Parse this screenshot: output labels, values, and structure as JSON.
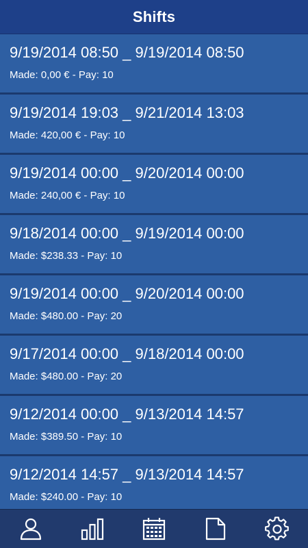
{
  "header": {
    "title": "Shifts"
  },
  "shifts": [
    {
      "range": "9/19/2014 08:50 _ 9/19/2014 08:50",
      "info": "Made: 0,00 € - Pay: 10"
    },
    {
      "range": "9/19/2014 19:03 _ 9/21/2014 13:03",
      "info": "Made: 420,00 € - Pay: 10"
    },
    {
      "range": "9/19/2014 00:00 _ 9/20/2014 00:00",
      "info": "Made: 240,00 € - Pay: 10"
    },
    {
      "range": "9/18/2014 00:00 _ 9/19/2014 00:00",
      "info": "Made: $238.33 - Pay: 10"
    },
    {
      "range": "9/19/2014 00:00 _ 9/20/2014 00:00",
      "info": "Made: $480.00 - Pay: 20"
    },
    {
      "range": "9/17/2014 00:00 _ 9/18/2014 00:00",
      "info": "Made: $480.00 - Pay: 20"
    },
    {
      "range": "9/12/2014 00:00 _ 9/13/2014 14:57",
      "info": "Made: $389.50 - Pay: 10"
    },
    {
      "range": "9/12/2014 14:57 _ 9/13/2014 14:57",
      "info": "Made: $240.00 - Pay: 10"
    }
  ],
  "tabbar": {
    "items": [
      {
        "icon": "person-icon"
      },
      {
        "icon": "bar-chart-icon"
      },
      {
        "icon": "calendar-icon"
      },
      {
        "icon": "document-icon"
      },
      {
        "icon": "gear-icon"
      }
    ]
  },
  "colors": {
    "header_bg": "#1e4089",
    "row_bg": "#2e5fa3",
    "row_divider": "#1b3a6e",
    "tabbar_bg": "#213a6d",
    "text": "#ffffff"
  }
}
